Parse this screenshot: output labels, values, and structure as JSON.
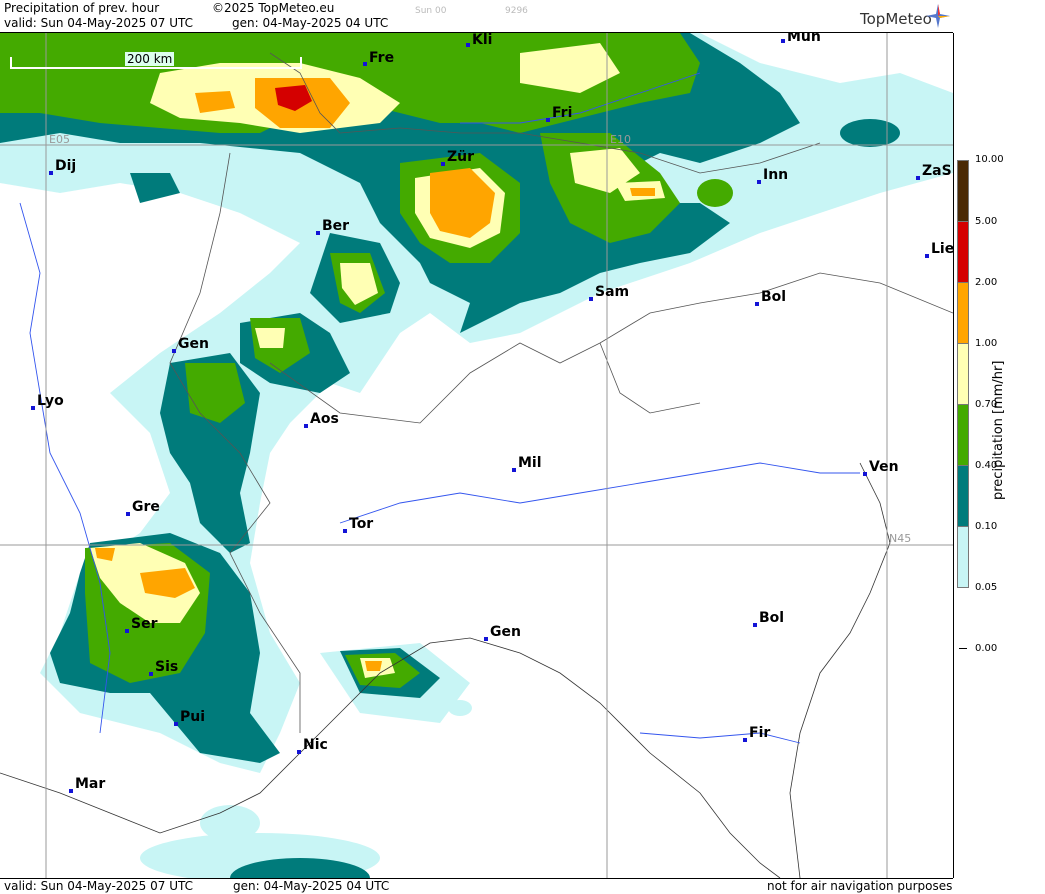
{
  "header": {
    "product": "Precipitation of prev. hour",
    "copyright": "©2025 TopMeteo.eu",
    "valid": "valid:  Sun  04-May-2025  07 UTC",
    "gen": "gen: 04-May-2025 04 UTC",
    "faint_code1": "Sun 00",
    "faint_code2": "9296",
    "logo": "TopMeteo"
  },
  "footer": {
    "valid": "valid:  Sun  04-May-2025  07 UTC",
    "gen": "gen: 04-May-2025 04 UTC",
    "note": "not for air navigation purposes"
  },
  "scale_bar": "200 km",
  "grid_labels": {
    "lon_e05": "E05",
    "lon_e10": "E10",
    "lat_n45": "N45"
  },
  "cities": [
    {
      "name": "Kli"
    },
    {
      "name": "Mün"
    },
    {
      "name": "Fre"
    },
    {
      "name": "Fri"
    },
    {
      "name": "Dij"
    },
    {
      "name": "Zür"
    },
    {
      "name": "Inn"
    },
    {
      "name": "ZaS"
    },
    {
      "name": "Ber"
    },
    {
      "name": "Lie"
    },
    {
      "name": "Sam"
    },
    {
      "name": "Bol"
    },
    {
      "name": "Gen"
    },
    {
      "name": "Lyo"
    },
    {
      "name": "Aos"
    },
    {
      "name": "Mil"
    },
    {
      "name": "Ven"
    },
    {
      "name": "Gre"
    },
    {
      "name": "Tor"
    },
    {
      "name": "Ser"
    },
    {
      "name": "Gen"
    },
    {
      "name": "Bol"
    },
    {
      "name": "Sis"
    },
    {
      "name": "Pui"
    },
    {
      "name": "Nic"
    },
    {
      "name": "Fir"
    },
    {
      "name": "Mar"
    }
  ],
  "legend": {
    "title": "precipitation [mm/hr]",
    "levels": [
      {
        "label": "10.00",
        "color": "#4a2a05"
      },
      {
        "label": "5.00",
        "color": "#d40000"
      },
      {
        "label": "2.00",
        "color": "#ffa500"
      },
      {
        "label": "1.00",
        "color": "#ffffb4"
      },
      {
        "label": "0.70",
        "color": "#44aa00"
      },
      {
        "label": "0.40",
        "color": "#007b7b"
      },
      {
        "label": "0.10",
        "color": "#c8f5f5"
      },
      {
        "label": "0.05",
        "color": "#ffffff"
      },
      {
        "label": "0.00",
        "color": "#ffffff"
      }
    ]
  },
  "colors": {
    "light_cyan": "#c8f5f5",
    "teal": "#007b7b",
    "green": "#44aa00",
    "pale_yellow": "#ffffb4",
    "orange": "#ffa500",
    "red": "#d40000",
    "city_marker": "#1313d6",
    "grid": "#999999"
  }
}
